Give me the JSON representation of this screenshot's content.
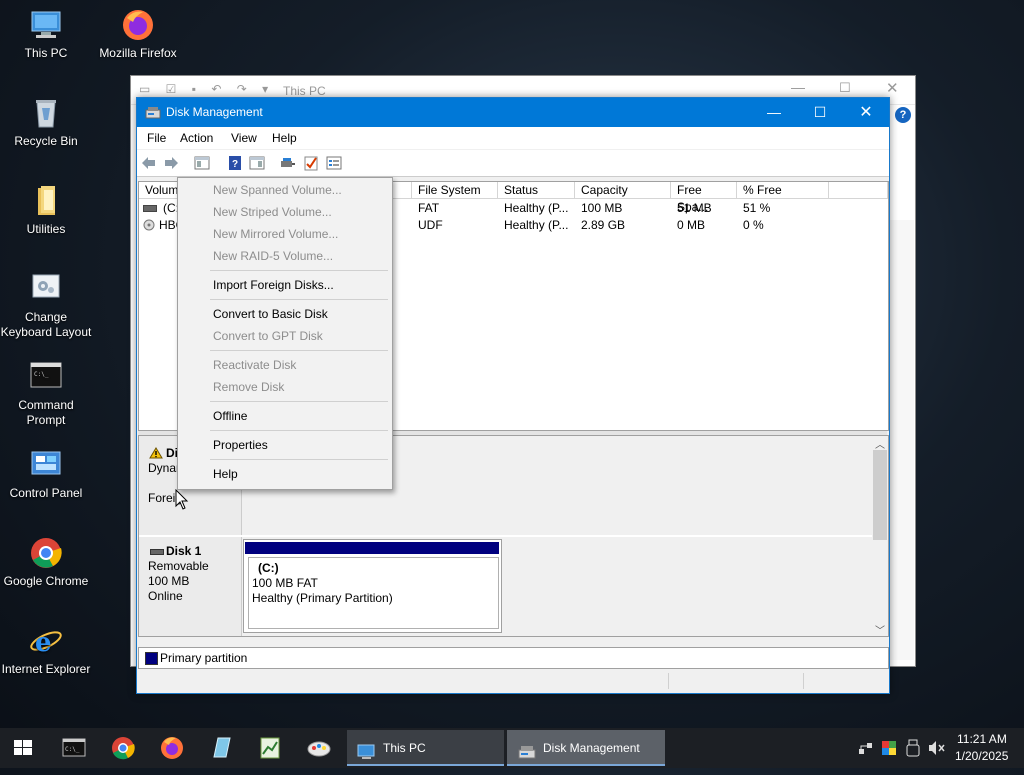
{
  "desktop": {
    "icons": [
      {
        "label": "This PC",
        "icon": "computer-icon"
      },
      {
        "label": "Mozilla Firefox",
        "icon": "firefox-icon"
      },
      {
        "label": "Recycle Bin",
        "icon": "recycle-bin-icon"
      },
      {
        "label": "Utilities",
        "icon": "folder-icon"
      },
      {
        "label": "Change Keyboard Layout",
        "icon": "keyboard-settings-icon"
      },
      {
        "label": "Command Prompt",
        "icon": "command-prompt-icon"
      },
      {
        "label": "Control Panel",
        "icon": "control-panel-icon"
      },
      {
        "label": "Google Chrome",
        "icon": "chrome-icon"
      },
      {
        "label": "Internet Explorer",
        "icon": "internet-explorer-icon"
      }
    ]
  },
  "background_window": {
    "title": "This PC"
  },
  "window": {
    "title": "Disk Management",
    "menu": [
      "File",
      "Action",
      "View",
      "Help"
    ],
    "columns": [
      "Volume",
      "File System",
      "Status",
      "Capacity",
      "Free Spa...",
      "% Free"
    ],
    "rows": [
      {
        "volume": "(C:",
        "file_system": "FAT",
        "status": "Healthy (P...",
        "capacity": "100 MB",
        "free": "51 MB",
        "pct_free": "51 %"
      },
      {
        "volume": "HBC",
        "file_system": "UDF",
        "status": "Healthy (P...",
        "capacity": "2.89 GB",
        "free": "0 MB",
        "pct_free": "0 %"
      }
    ],
    "disk0": {
      "name": "Di",
      "type": "Dynar",
      "state": "Foreig"
    },
    "disk1": {
      "name": "Disk 1",
      "type": "Removable",
      "size": "100 MB",
      "state": "Online",
      "partition": {
        "letter": "(C:)",
        "size_fs": "100 MB FAT",
        "status": "Healthy (Primary Partition)"
      }
    },
    "legend": "Primary partition",
    "colors": {
      "primary_partition": "#00007f",
      "titlebar": "#0078d7"
    }
  },
  "context_menu": {
    "items": [
      {
        "label": "New Spanned Volume...",
        "enabled": false
      },
      {
        "label": "New Striped Volume...",
        "enabled": false
      },
      {
        "label": "New Mirrored Volume...",
        "enabled": false
      },
      {
        "label": "New RAID-5 Volume...",
        "enabled": false
      },
      {
        "label": "Import Foreign Disks...",
        "enabled": true
      },
      {
        "label": "Convert to Basic Disk",
        "enabled": true
      },
      {
        "label": "Convert to GPT Disk",
        "enabled": false
      },
      {
        "label": "Reactivate Disk",
        "enabled": false
      },
      {
        "label": "Remove Disk",
        "enabled": false
      },
      {
        "label": "Offline",
        "enabled": true
      },
      {
        "label": "Properties",
        "enabled": true
      },
      {
        "label": "Help",
        "enabled": true
      }
    ]
  },
  "taskbar": {
    "tasks": [
      {
        "label": "This PC",
        "icon": "this-pc-icon"
      },
      {
        "label": "Disk Management",
        "icon": "disk-management-icon"
      }
    ],
    "clock": {
      "time": "11:21 AM",
      "date": "1/20/2025"
    }
  }
}
